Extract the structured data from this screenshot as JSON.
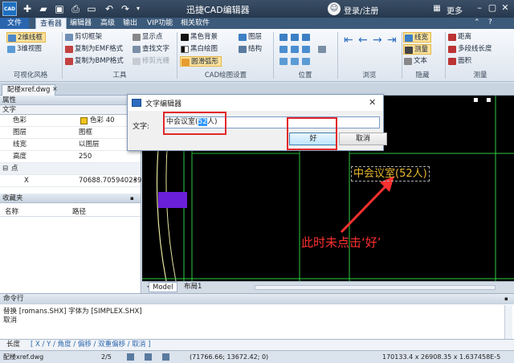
{
  "window": {
    "title": "迅捷CAD编辑器",
    "login": "登录/注册",
    "more": "更多",
    "logo": "CAD"
  },
  "menu": {
    "file": "文件",
    "items": [
      "查看器",
      "编辑器",
      "高级",
      "输出",
      "VIP功能",
      "相关软件"
    ]
  },
  "ribbon": {
    "groups": [
      {
        "label": "可视化风格",
        "items": [
          "2维线框",
          "3维视图"
        ]
      },
      {
        "label": "工具",
        "items": [
          "剪切框架",
          "复制为EMF格式",
          "复制为BMP格式",
          "显示点",
          "查找文字",
          "修剪光栅"
        ]
      },
      {
        "label": "CAD绘图设置",
        "items": [
          "黑色背景",
          "黑白绘图",
          "圆滑弧形",
          "图层",
          "结构"
        ]
      },
      {
        "label": "位置"
      },
      {
        "label": "浏览"
      },
      {
        "label": "隐藏",
        "items": [
          "线宽",
          "测量",
          "文本"
        ]
      },
      {
        "label": "测量",
        "items": [
          "距离",
          "多段线长度",
          "面积"
        ]
      }
    ]
  },
  "document": {
    "tab": "配楼xref.dwg",
    "close": "×"
  },
  "properties": {
    "title": "属性",
    "section_text": "文字",
    "rows": [
      {
        "key": "色彩",
        "value": "色彩 40"
      },
      {
        "key": "图层",
        "value": "图框"
      },
      {
        "key": "线宽",
        "value": "以图层"
      },
      {
        "key": "高度",
        "value": "250"
      }
    ],
    "section_point": "点",
    "point_row": {
      "key": "X",
      "value": "70688.705940239"
    }
  },
  "favorites": {
    "title": "收藏夹",
    "col_name": "名称",
    "col_path": "路径"
  },
  "dialog": {
    "title": "文字编辑器",
    "label": "文字:",
    "value_before": "中会议室(",
    "value_selected": "52",
    "value_after": "人)",
    "ok": "好",
    "cancel": "取消"
  },
  "canvas": {
    "room_label": "中会议室(52人)",
    "annotation": "此时未点击‘好’"
  },
  "layout_tabs": [
    "Model",
    "布局1"
  ],
  "command": {
    "title": "命令行",
    "lines": [
      "替换 [romans.SHX] 字体为 [SIMPLEX.SHX]",
      "取消"
    ],
    "input_label": "长度",
    "options": "[ X / Y / 角度 / 偏移 / 双重偏移 / 取消 ]"
  },
  "status": {
    "file": "配楼xref.dwg",
    "page": "2/5",
    "coords": "(71766.66; 13672.42; 0)",
    "extent": "170133.4 x 26908.35 x 1.637458E-5"
  },
  "colors": {
    "accent": "#2a65ae",
    "highlight": "#fde29b",
    "annotation": "#ff3030",
    "label": "#e8b92f"
  }
}
